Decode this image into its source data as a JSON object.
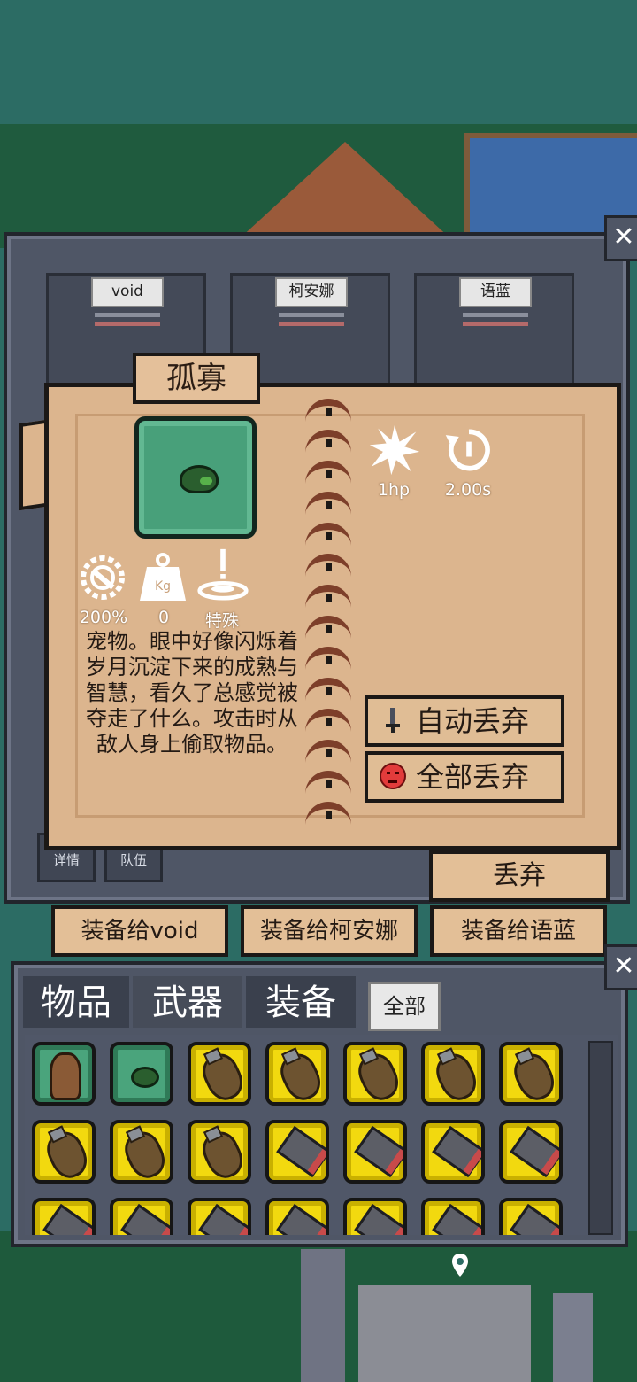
{
  "colors": {
    "panel": "#4f5666",
    "parchment": "#dcb58e",
    "item_frame_green": "#48a07a",
    "item_frame_yellow": "#f2d90f",
    "text_dark": "#241a14"
  },
  "window": {
    "close_label": "✕"
  },
  "team_slots": [
    {
      "name": "void"
    },
    {
      "name": "柯安娜"
    },
    {
      "name": "语蓝"
    }
  ],
  "side_buttons": {
    "details": "详情",
    "team": "队伍"
  },
  "item_card": {
    "title": "孤寡",
    "icon": "green-blob-icon",
    "attack_stats": [
      {
        "icon": "burst-icon",
        "label": "1hp"
      },
      {
        "icon": "cooldown-icon",
        "label": "2.00s"
      }
    ],
    "properties": [
      {
        "icon": "gear-wrench-icon",
        "label": "200%"
      },
      {
        "icon": "weight-icon",
        "label": "0",
        "icon_text": "Kg"
      },
      {
        "icon": "special-icon",
        "label": "特殊"
      }
    ],
    "description": "宠物。眼中好像闪烁着岁月沉淀下来的成熟与智慧，看久了总感觉被夺走了什么。攻击时从敌人身上偷取物品。",
    "auto_discard_label": "自动丢弃",
    "discard_all_label": "全部丢弃"
  },
  "actions": {
    "discard": "丢弃",
    "equip": [
      "装备给void",
      "装备给柯安娜",
      "装备给语蓝"
    ]
  },
  "inventory": {
    "tabs": [
      "物品",
      "武器",
      "装备"
    ],
    "filter_all": "全部",
    "items": [
      {
        "type": "otter",
        "frame": "green"
      },
      {
        "type": "blob",
        "frame": "green"
      },
      {
        "type": "grenade",
        "frame": "yellow"
      },
      {
        "type": "grenade",
        "frame": "yellow"
      },
      {
        "type": "grenade",
        "frame": "yellow"
      },
      {
        "type": "grenade",
        "frame": "yellow"
      },
      {
        "type": "grenade",
        "frame": "yellow"
      },
      {
        "type": "grenade",
        "frame": "yellow"
      },
      {
        "type": "grenade",
        "frame": "yellow"
      },
      {
        "type": "grenade",
        "frame": "yellow"
      },
      {
        "type": "canister",
        "frame": "yellow"
      },
      {
        "type": "canister",
        "frame": "yellow"
      },
      {
        "type": "canister",
        "frame": "yellow"
      },
      {
        "type": "canister",
        "frame": "yellow"
      },
      {
        "type": "canister",
        "frame": "yellow"
      },
      {
        "type": "canister",
        "frame": "yellow"
      },
      {
        "type": "canister",
        "frame": "yellow"
      },
      {
        "type": "canister",
        "frame": "yellow"
      },
      {
        "type": "canister",
        "frame": "yellow"
      },
      {
        "type": "canister",
        "frame": "yellow"
      },
      {
        "type": "canister",
        "frame": "yellow"
      }
    ]
  }
}
